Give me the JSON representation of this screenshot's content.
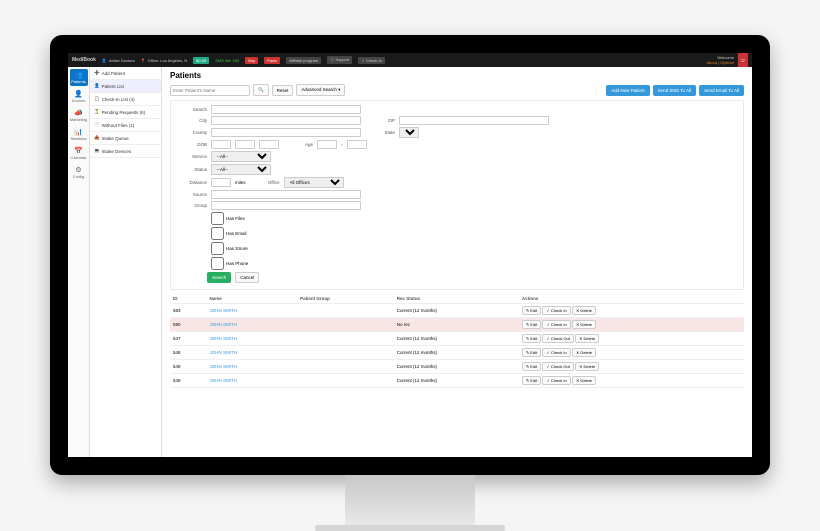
{
  "brand": "MediBook",
  "topbar": {
    "active_doctors": "Active Doctors",
    "office": "Office: Los Angeles, N",
    "balance": "$0.00",
    "sms": "SMS left: 250",
    "buy": "Buy",
    "panic": "Panic",
    "affiliate": "Affiliate program",
    "support": "Support",
    "checkin": "Check-In",
    "welcome": "Welcome",
    "user": "About | Options"
  },
  "rail": [
    {
      "ic": "👥",
      "label": "Patients",
      "active": true
    },
    {
      "ic": "👤",
      "label": "Doctors"
    },
    {
      "ic": "📣",
      "label": "Marketing"
    },
    {
      "ic": "📊",
      "label": "Statistics"
    },
    {
      "ic": "📅",
      "label": "Calendar"
    },
    {
      "ic": "⚙",
      "label": "Config"
    }
  ],
  "subnav": [
    {
      "ic": "➕",
      "label": "Add Patient"
    },
    {
      "ic": "👤",
      "label": "Patient List",
      "active": true
    },
    {
      "ic": "📋",
      "label": "Check-In List (4)"
    },
    {
      "ic": "⏳",
      "label": "Pending Requests (6)"
    },
    {
      "ic": "📄",
      "label": "Without Files (1)"
    },
    {
      "ic": "📥",
      "label": "Intake Queue"
    },
    {
      "ic": "💻",
      "label": "Intake Devices"
    }
  ],
  "page": {
    "title": "Patients",
    "search_placeholder": "Enter Patient's Name",
    "reset": "Reset",
    "advanced": "Advanced Search ▾",
    "add_btn": "Add New Patient",
    "sms_btn": "Send SMS To All",
    "email_btn": "Send Email To All"
  },
  "adv": {
    "search": "Search",
    "city": "City",
    "zip": "ZIP",
    "county": "County",
    "state": "State",
    "dob": "DOB",
    "age": "Age",
    "service": "Service",
    "status": "Status",
    "distance": "Distance",
    "miles": "miles",
    "office": "Office",
    "all_offices": "All Offices",
    "source": "Source",
    "group": "Group",
    "all": "--All--",
    "has_files": "Has Files",
    "has_email": "Has Email",
    "has_secure": "Has SSure",
    "has_phone": "Has Phone",
    "search_btn": "Search",
    "cancel": "Cancel"
  },
  "table": {
    "head": {
      "id": "ID",
      "name": "Name",
      "group": "Patient Group",
      "rec": "Rec Status",
      "actions": "Actions"
    },
    "rows": [
      {
        "id": "583",
        "name": "JOHN SMITH",
        "group": "",
        "rec": "Current (12 months)"
      },
      {
        "id": "590",
        "name": "JOHN SMITH",
        "group": "",
        "rec": "No rec",
        "danger": true
      },
      {
        "id": "547",
        "name": "JOHN SMITH",
        "group": "",
        "rec": "Current (12 months)",
        "out": true
      },
      {
        "id": "548",
        "name": "JOHN SMITH",
        "group": "",
        "rec": "Current (12 months)"
      },
      {
        "id": "549",
        "name": "JOHN SMITH",
        "group": "",
        "rec": "Current (12 months)",
        "out": true
      },
      {
        "id": "549",
        "name": "JOHN SMITH",
        "group": "",
        "rec": "Current (12 months)"
      }
    ],
    "edit": "Edit",
    "checkin": "Check In",
    "checkout": "Check Out",
    "delete": "Delete"
  }
}
